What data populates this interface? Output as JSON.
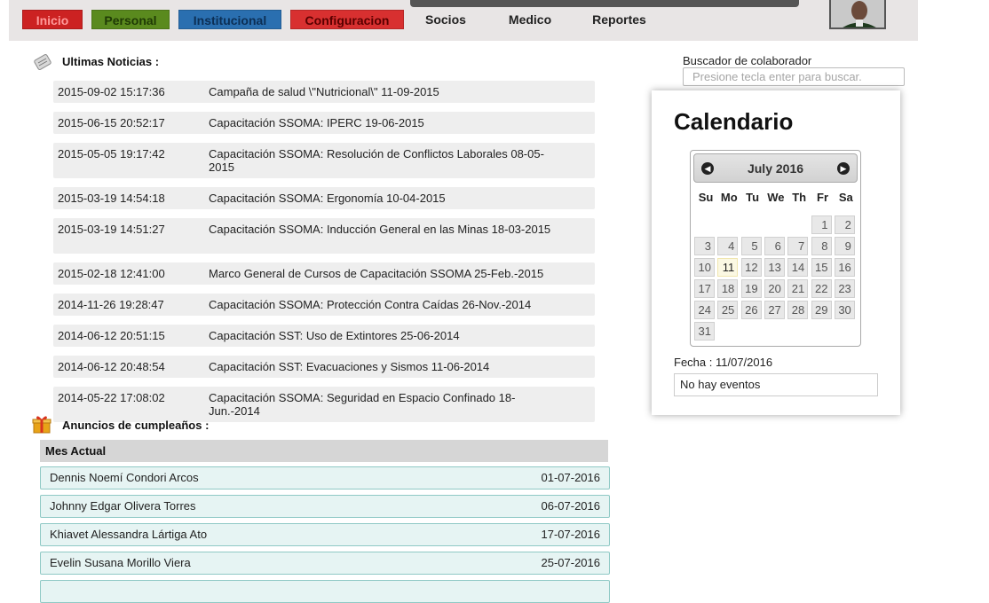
{
  "nav": {
    "items": [
      {
        "label": "Inicio",
        "bg": "#cc2222",
        "fg": "#ff9a9a",
        "w": 68
      },
      {
        "label": "Personal",
        "bg": "#5a8a1e",
        "fg": "#1f3a05",
        "w": 88
      },
      {
        "label": "Institucional",
        "bg": "#2a6fb0",
        "fg": "#0c2f55",
        "w": 116
      },
      {
        "label": "Configuracion",
        "bg": "#d83030",
        "fg": "#5a0000",
        "w": 128
      }
    ],
    "plain": [
      "Socios",
      "Medico",
      "Reportes"
    ]
  },
  "news": {
    "title": "Ultimas Noticias :",
    "items": [
      {
        "date": "2015-09-02 15:17:36",
        "title": "Campaña de salud \\\"Nutricional\\\" 11-09-2015"
      },
      {
        "date": "2015-06-15 20:52:17",
        "title": "Capacitación SSOMA: IPERC 19-06-2015"
      },
      {
        "date": "2015-05-05 19:17:42",
        "title": "Capacitación SSOMA: Resolución de Conflictos Laborales 08-05-2015"
      },
      {
        "date": "2015-03-19 14:54:18",
        "title": "Capacitación SSOMA: Ergonomía 10-04-2015"
      },
      {
        "date": "2015-03-19 14:51:27",
        "title": "Capacitación SSOMA: Inducción General en las Minas 18-03-2015"
      },
      {
        "date": "2015-02-18 12:41:00",
        "title": "Marco General de Cursos de Capacitación SSOMA 25-Feb.-2015"
      },
      {
        "date": "2014-11-26 19:28:47",
        "title": "Capacitación SSOMA: Protección Contra Caídas 26-Nov.-2014"
      },
      {
        "date": "2014-06-12 20:51:15",
        "title": "Capacitación SST: Uso de Extintores 25-06-2014"
      },
      {
        "date": "2014-06-12 20:48:54",
        "title": "Capacitación SST: Evacuaciones y Sismos 11-06-2014"
      },
      {
        "date": "2014-05-22 17:08:02",
        "title": "Capacitación SSOMA: Seguridad en Espacio Confinado 18-Jun.-2014"
      }
    ]
  },
  "birthdays": {
    "title": "Anuncios de cumpleaños :",
    "header": "Mes Actual",
    "rows": [
      {
        "name": "Dennis Noemí Condori Arcos",
        "date": "01-07-2016"
      },
      {
        "name": "Johnny Edgar Olivera Torres",
        "date": "06-07-2016"
      },
      {
        "name": "Khiavet Alessandra Lártiga Ato",
        "date": "17-07-2016"
      },
      {
        "name": "Evelin Susana Morillo Viera",
        "date": "25-07-2016"
      }
    ]
  },
  "search": {
    "label": "Buscador de colaborador",
    "placeholder": "Presione tecla enter para buscar."
  },
  "calendar": {
    "title": "Calendario",
    "month_label": "July 2016",
    "weekdays": [
      "Su",
      "Mo",
      "Tu",
      "We",
      "Th",
      "Fr",
      "Sa"
    ],
    "first_weekday": 5,
    "days_in_month": 31,
    "today": 11,
    "fecha_label": "Fecha :",
    "fecha_value": "11/07/2016",
    "events_text": "No hay eventos"
  }
}
